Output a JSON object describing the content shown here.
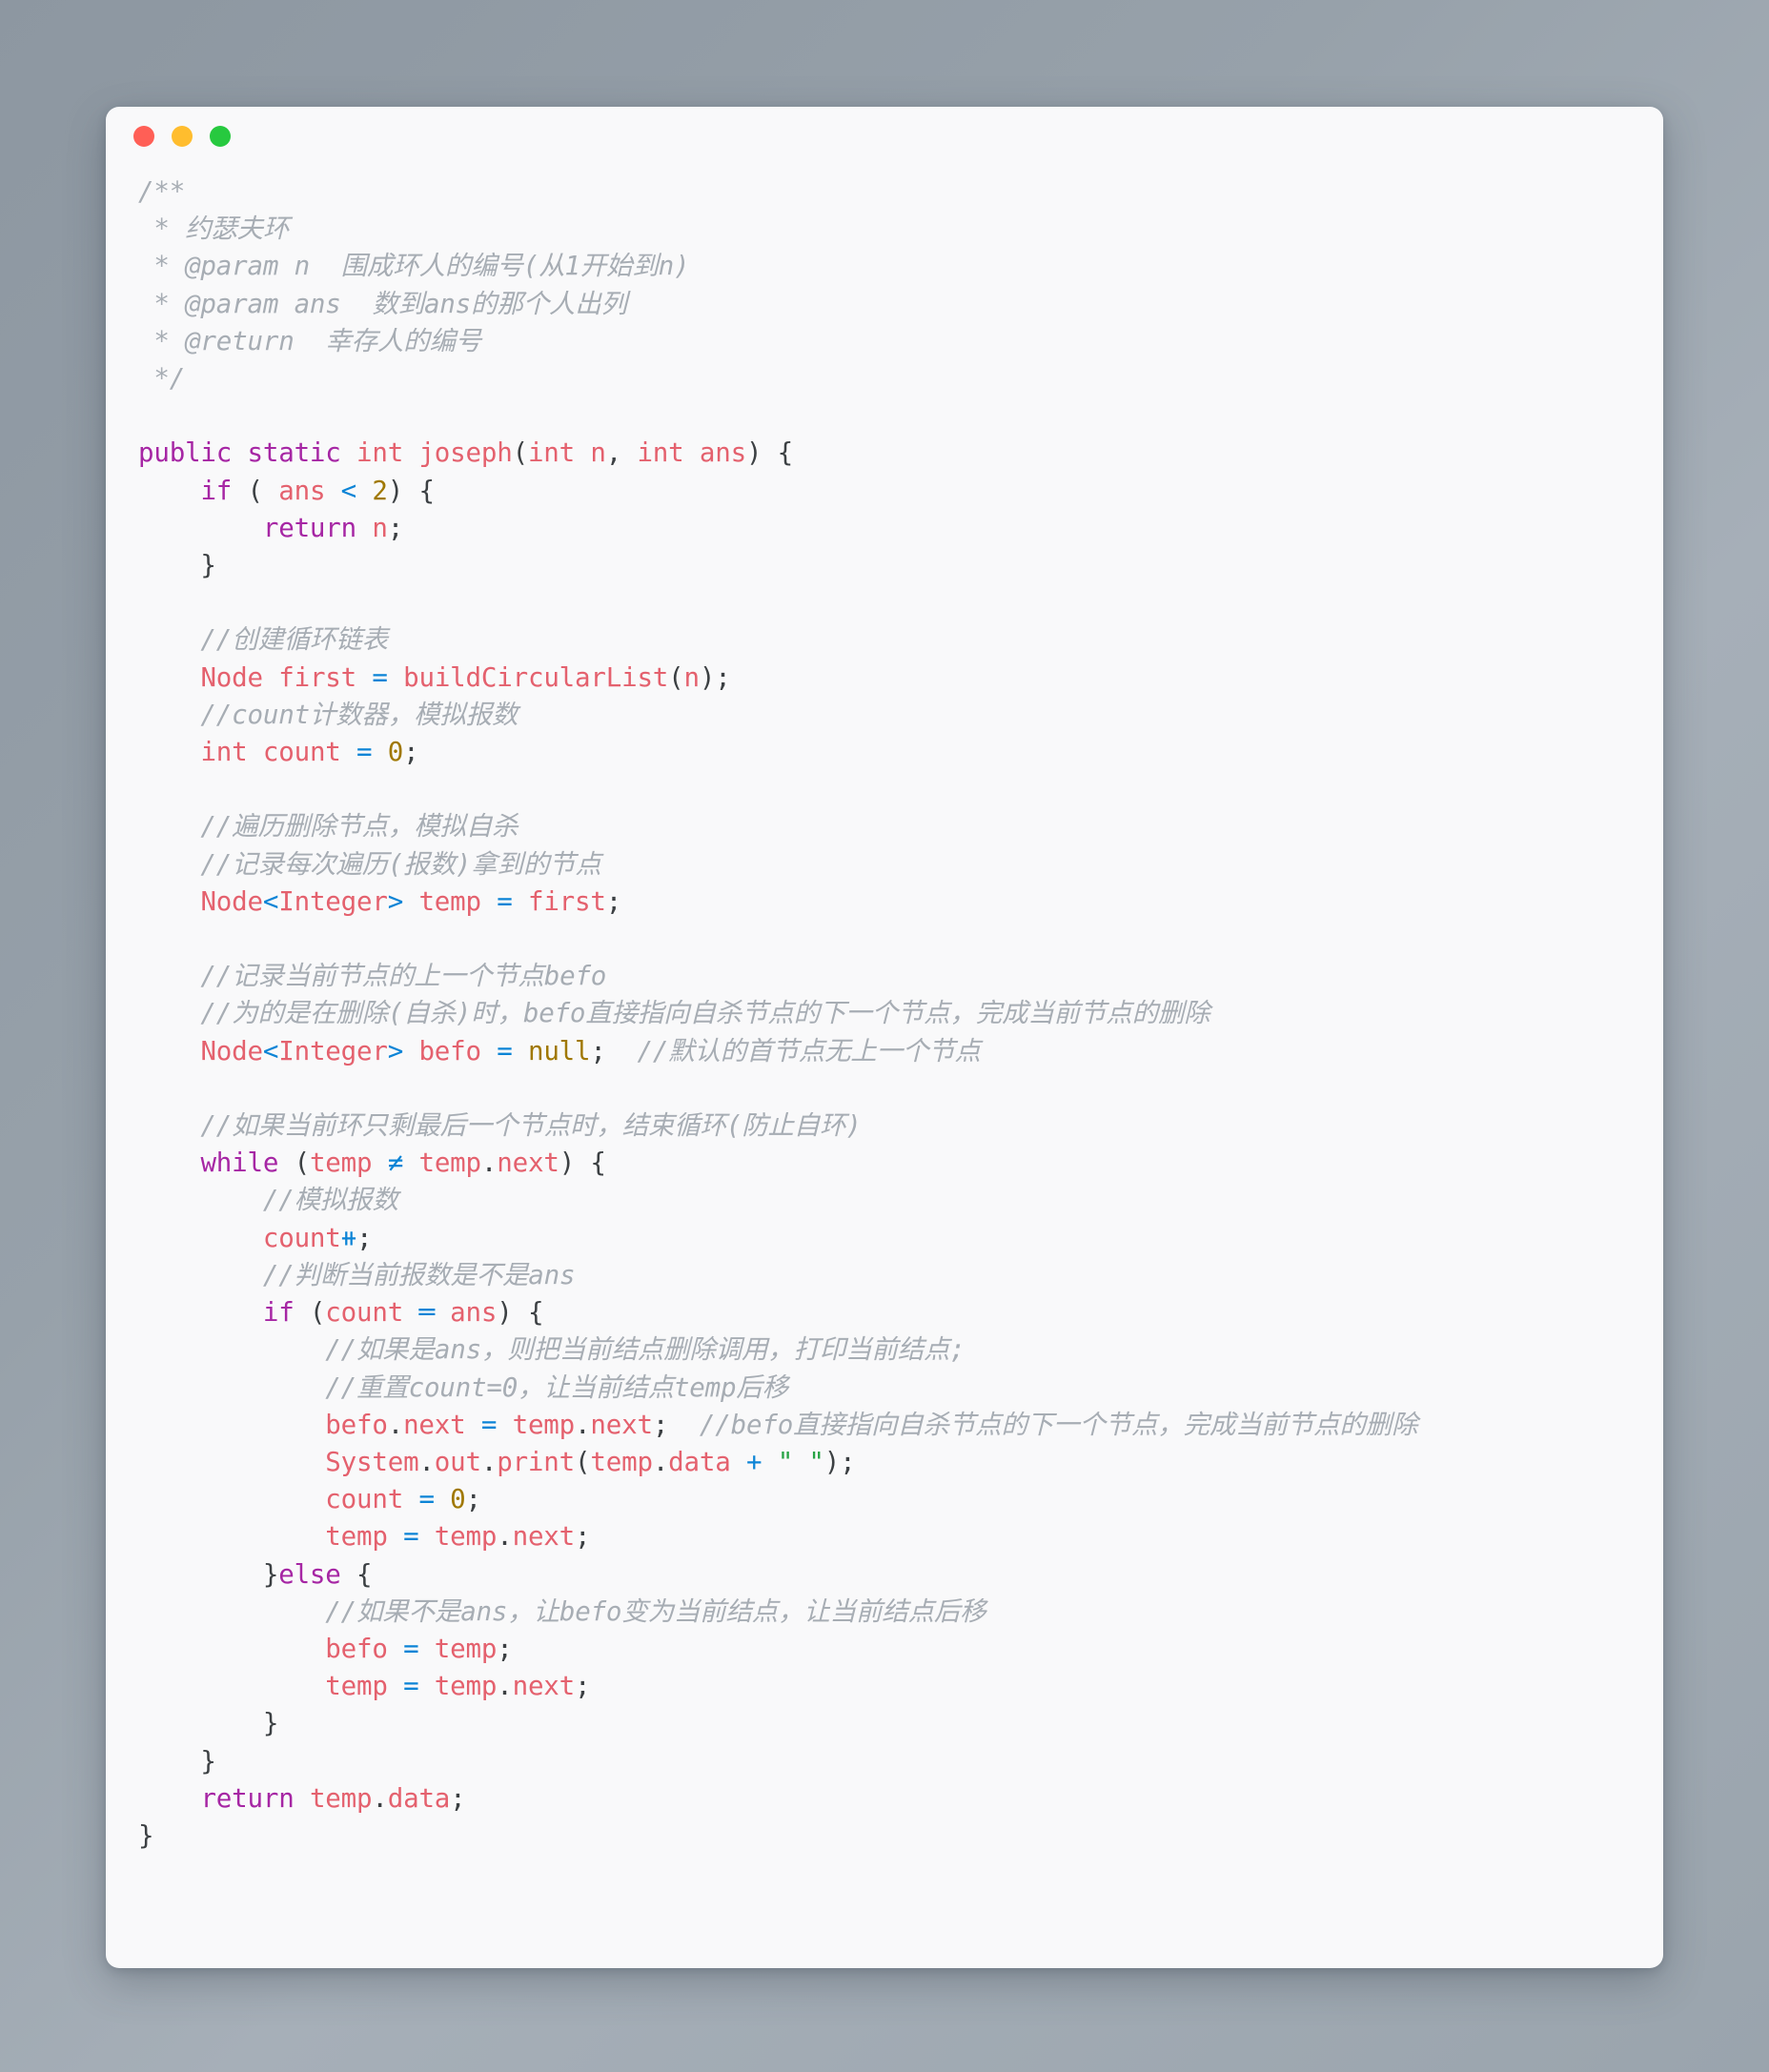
{
  "window": {
    "traffic_lights": [
      {
        "name": "close",
        "color": "#ff5f56"
      },
      {
        "name": "minimize",
        "color": "#ffbd2e"
      },
      {
        "name": "maximize",
        "color": "#27c93f"
      }
    ]
  },
  "editor": {
    "language": "java",
    "theme_colors": {
      "background": "#f9f9fa",
      "comment": "#a7adb4",
      "keyword": "#a626a4",
      "identifier": "#e4616e",
      "number": "#a07800",
      "operator": "#0c84d6",
      "string": "#26a344",
      "punctuation": "#3c4043"
    },
    "lines": [
      [
        {
          "t": "/**",
          "c": "cmt"
        }
      ],
      [
        {
          "t": " * 约瑟夫环",
          "c": "cmt"
        }
      ],
      [
        {
          "t": " * @param n  围成环人的编号(从1开始到n)",
          "c": "cmt"
        }
      ],
      [
        {
          "t": " * @param ans  数到ans的那个人出列",
          "c": "cmt"
        }
      ],
      [
        {
          "t": " * @return  幸存人的编号",
          "c": "cmt"
        }
      ],
      [
        {
          "t": " */",
          "c": "cmt"
        }
      ],
      [],
      [
        {
          "t": "public",
          "c": "kw"
        },
        {
          "t": " ",
          "c": "punc"
        },
        {
          "t": "static",
          "c": "kw"
        },
        {
          "t": " ",
          "c": "punc"
        },
        {
          "t": "int",
          "c": "id"
        },
        {
          "t": " ",
          "c": "punc"
        },
        {
          "t": "joseph",
          "c": "id"
        },
        {
          "t": "(",
          "c": "punc"
        },
        {
          "t": "int",
          "c": "id"
        },
        {
          "t": " ",
          "c": "punc"
        },
        {
          "t": "n",
          "c": "id"
        },
        {
          "t": ", ",
          "c": "punc"
        },
        {
          "t": "int",
          "c": "id"
        },
        {
          "t": " ",
          "c": "punc"
        },
        {
          "t": "ans",
          "c": "id"
        },
        {
          "t": ") {",
          "c": "punc"
        }
      ],
      [
        {
          "t": "    ",
          "c": "punc"
        },
        {
          "t": "if",
          "c": "kw"
        },
        {
          "t": " ( ",
          "c": "punc"
        },
        {
          "t": "ans",
          "c": "id"
        },
        {
          "t": " ",
          "c": "punc"
        },
        {
          "t": "<",
          "c": "op"
        },
        {
          "t": " ",
          "c": "punc"
        },
        {
          "t": "2",
          "c": "num"
        },
        {
          "t": ") {",
          "c": "punc"
        }
      ],
      [
        {
          "t": "        ",
          "c": "punc"
        },
        {
          "t": "return",
          "c": "kw"
        },
        {
          "t": " ",
          "c": "punc"
        },
        {
          "t": "n",
          "c": "id"
        },
        {
          "t": ";",
          "c": "punc"
        }
      ],
      [
        {
          "t": "    }",
          "c": "punc"
        }
      ],
      [],
      [
        {
          "t": "    //创建循环链表",
          "c": "cmt"
        }
      ],
      [
        {
          "t": "    ",
          "c": "punc"
        },
        {
          "t": "Node",
          "c": "id"
        },
        {
          "t": " ",
          "c": "punc"
        },
        {
          "t": "first",
          "c": "id"
        },
        {
          "t": " ",
          "c": "punc"
        },
        {
          "t": "=",
          "c": "op"
        },
        {
          "t": " ",
          "c": "punc"
        },
        {
          "t": "buildCircularList",
          "c": "id"
        },
        {
          "t": "(",
          "c": "punc"
        },
        {
          "t": "n",
          "c": "id"
        },
        {
          "t": ");",
          "c": "punc"
        }
      ],
      [
        {
          "t": "    //count计数器，模拟报数",
          "c": "cmt"
        }
      ],
      [
        {
          "t": "    ",
          "c": "punc"
        },
        {
          "t": "int",
          "c": "id"
        },
        {
          "t": " ",
          "c": "punc"
        },
        {
          "t": "count",
          "c": "id"
        },
        {
          "t": " ",
          "c": "punc"
        },
        {
          "t": "=",
          "c": "op"
        },
        {
          "t": " ",
          "c": "punc"
        },
        {
          "t": "0",
          "c": "num"
        },
        {
          "t": ";",
          "c": "punc"
        }
      ],
      [],
      [
        {
          "t": "    //遍历删除节点，模拟自杀",
          "c": "cmt"
        }
      ],
      [
        {
          "t": "    //记录每次遍历(报数)拿到的节点",
          "c": "cmt"
        }
      ],
      [
        {
          "t": "    ",
          "c": "punc"
        },
        {
          "t": "Node",
          "c": "id"
        },
        {
          "t": "<",
          "c": "op"
        },
        {
          "t": "Integer",
          "c": "id"
        },
        {
          "t": ">",
          "c": "op"
        },
        {
          "t": " ",
          "c": "punc"
        },
        {
          "t": "temp",
          "c": "id"
        },
        {
          "t": " ",
          "c": "punc"
        },
        {
          "t": "=",
          "c": "op"
        },
        {
          "t": " ",
          "c": "punc"
        },
        {
          "t": "first",
          "c": "id"
        },
        {
          "t": ";",
          "c": "punc"
        }
      ],
      [],
      [
        {
          "t": "    //记录当前节点的上一个节点befo",
          "c": "cmt"
        }
      ],
      [
        {
          "t": "    //为的是在删除(自杀)时，befo直接指向自杀节点的下一个节点，完成当前节点的删除",
          "c": "cmt"
        }
      ],
      [
        {
          "t": "    ",
          "c": "punc"
        },
        {
          "t": "Node",
          "c": "id"
        },
        {
          "t": "<",
          "c": "op"
        },
        {
          "t": "Integer",
          "c": "id"
        },
        {
          "t": ">",
          "c": "op"
        },
        {
          "t": " ",
          "c": "punc"
        },
        {
          "t": "befo",
          "c": "id"
        },
        {
          "t": " ",
          "c": "punc"
        },
        {
          "t": "=",
          "c": "op"
        },
        {
          "t": " ",
          "c": "punc"
        },
        {
          "t": "null",
          "c": "num"
        },
        {
          "t": ";  ",
          "c": "punc"
        },
        {
          "t": "//默认的首节点无上一个节点",
          "c": "cmt"
        }
      ],
      [],
      [
        {
          "t": "    //如果当前环只剩最后一个节点时，结束循环(防止自环)",
          "c": "cmt"
        }
      ],
      [
        {
          "t": "    ",
          "c": "punc"
        },
        {
          "t": "while",
          "c": "kw"
        },
        {
          "t": " (",
          "c": "punc"
        },
        {
          "t": "temp",
          "c": "id"
        },
        {
          "t": " ",
          "c": "punc"
        },
        {
          "t": "≠",
          "c": "op"
        },
        {
          "t": " ",
          "c": "punc"
        },
        {
          "t": "temp",
          "c": "id"
        },
        {
          "t": ".",
          "c": "punc"
        },
        {
          "t": "next",
          "c": "id"
        },
        {
          "t": ") {",
          "c": "punc"
        }
      ],
      [
        {
          "t": "        //模拟报数",
          "c": "cmt"
        }
      ],
      [
        {
          "t": "        ",
          "c": "punc"
        },
        {
          "t": "count",
          "c": "id"
        },
        {
          "t": "⧺",
          "c": "op"
        },
        {
          "t": ";",
          "c": "punc"
        }
      ],
      [
        {
          "t": "        //判断当前报数是不是ans",
          "c": "cmt"
        }
      ],
      [
        {
          "t": "        ",
          "c": "punc"
        },
        {
          "t": "if",
          "c": "kw"
        },
        {
          "t": " (",
          "c": "punc"
        },
        {
          "t": "count",
          "c": "id"
        },
        {
          "t": " ",
          "c": "punc"
        },
        {
          "t": "═",
          "c": "op"
        },
        {
          "t": " ",
          "c": "punc"
        },
        {
          "t": "ans",
          "c": "id"
        },
        {
          "t": ") {",
          "c": "punc"
        }
      ],
      [
        {
          "t": "            //如果是ans，则把当前结点删除调用，打印当前结点;",
          "c": "cmt"
        }
      ],
      [
        {
          "t": "            //重置count=0，让当前结点temp后移",
          "c": "cmt"
        }
      ],
      [
        {
          "t": "            ",
          "c": "punc"
        },
        {
          "t": "befo",
          "c": "id"
        },
        {
          "t": ".",
          "c": "punc"
        },
        {
          "t": "next",
          "c": "id"
        },
        {
          "t": " ",
          "c": "punc"
        },
        {
          "t": "=",
          "c": "op"
        },
        {
          "t": " ",
          "c": "punc"
        },
        {
          "t": "temp",
          "c": "id"
        },
        {
          "t": ".",
          "c": "punc"
        },
        {
          "t": "next",
          "c": "id"
        },
        {
          "t": ";  ",
          "c": "punc"
        },
        {
          "t": "//befo直接指向自杀节点的下一个节点，完成当前节点的删除",
          "c": "cmt"
        }
      ],
      [
        {
          "t": "            ",
          "c": "punc"
        },
        {
          "t": "System",
          "c": "id"
        },
        {
          "t": ".",
          "c": "punc"
        },
        {
          "t": "out",
          "c": "id"
        },
        {
          "t": ".",
          "c": "punc"
        },
        {
          "t": "print",
          "c": "id"
        },
        {
          "t": "(",
          "c": "punc"
        },
        {
          "t": "temp",
          "c": "id"
        },
        {
          "t": ".",
          "c": "punc"
        },
        {
          "t": "data",
          "c": "id"
        },
        {
          "t": " ",
          "c": "punc"
        },
        {
          "t": "+",
          "c": "op"
        },
        {
          "t": " ",
          "c": "punc"
        },
        {
          "t": "\" \"",
          "c": "str"
        },
        {
          "t": ");",
          "c": "punc"
        }
      ],
      [
        {
          "t": "            ",
          "c": "punc"
        },
        {
          "t": "count",
          "c": "id"
        },
        {
          "t": " ",
          "c": "punc"
        },
        {
          "t": "=",
          "c": "op"
        },
        {
          "t": " ",
          "c": "punc"
        },
        {
          "t": "0",
          "c": "num"
        },
        {
          "t": ";",
          "c": "punc"
        }
      ],
      [
        {
          "t": "            ",
          "c": "punc"
        },
        {
          "t": "temp",
          "c": "id"
        },
        {
          "t": " ",
          "c": "punc"
        },
        {
          "t": "=",
          "c": "op"
        },
        {
          "t": " ",
          "c": "punc"
        },
        {
          "t": "temp",
          "c": "id"
        },
        {
          "t": ".",
          "c": "punc"
        },
        {
          "t": "next",
          "c": "id"
        },
        {
          "t": ";",
          "c": "punc"
        }
      ],
      [
        {
          "t": "        }",
          "c": "punc"
        },
        {
          "t": "else",
          "c": "kw"
        },
        {
          "t": " {",
          "c": "punc"
        }
      ],
      [
        {
          "t": "            //如果不是ans，让befo变为当前结点，让当前结点后移",
          "c": "cmt"
        }
      ],
      [
        {
          "t": "            ",
          "c": "punc"
        },
        {
          "t": "befo",
          "c": "id"
        },
        {
          "t": " ",
          "c": "punc"
        },
        {
          "t": "=",
          "c": "op"
        },
        {
          "t": " ",
          "c": "punc"
        },
        {
          "t": "temp",
          "c": "id"
        },
        {
          "t": ";",
          "c": "punc"
        }
      ],
      [
        {
          "t": "            ",
          "c": "punc"
        },
        {
          "t": "temp",
          "c": "id"
        },
        {
          "t": " ",
          "c": "punc"
        },
        {
          "t": "=",
          "c": "op"
        },
        {
          "t": " ",
          "c": "punc"
        },
        {
          "t": "temp",
          "c": "id"
        },
        {
          "t": ".",
          "c": "punc"
        },
        {
          "t": "next",
          "c": "id"
        },
        {
          "t": ";",
          "c": "punc"
        }
      ],
      [
        {
          "t": "        }",
          "c": "punc"
        }
      ],
      [
        {
          "t": "    }",
          "c": "punc"
        }
      ],
      [
        {
          "t": "    ",
          "c": "punc"
        },
        {
          "t": "return",
          "c": "kw"
        },
        {
          "t": " ",
          "c": "punc"
        },
        {
          "t": "temp",
          "c": "id"
        },
        {
          "t": ".",
          "c": "punc"
        },
        {
          "t": "data",
          "c": "id"
        },
        {
          "t": ";",
          "c": "punc"
        }
      ],
      [
        {
          "t": "}",
          "c": "punc"
        }
      ]
    ]
  }
}
